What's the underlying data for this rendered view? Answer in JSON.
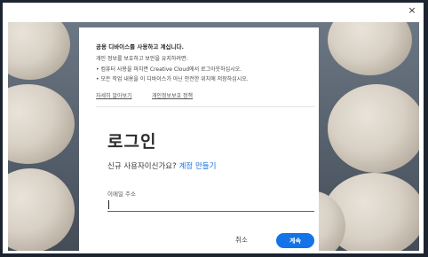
{
  "window": {
    "close_glyph": "×"
  },
  "notice": {
    "title": "공용 디바이스를 사용하고 계십니다.",
    "subtitle": "개인 정보를 보호하고 보안을 유지하려면:",
    "bullets": [
      "• 컴퓨터 사용을 마치면 Creative Cloud에서 로그아웃하십시오.",
      "• 모든 작업 내용을 이 디바이스가 아닌 안전한 위치에 저장하십시오."
    ],
    "learn_more_link": "자세히 알아보기",
    "privacy_link": "개인정보보호 정책"
  },
  "signin": {
    "heading": "로그인",
    "new_user_text": "신규 사용자이신가요?",
    "create_account_link": "계정 만들기",
    "email_label": "이메일 주소",
    "email_value": ""
  },
  "actions": {
    "cancel_label": "취소",
    "continue_label": "계속"
  },
  "colors": {
    "accent": "#1473e6",
    "background": "#1c2430"
  },
  "icons": {
    "close": "close-icon"
  }
}
